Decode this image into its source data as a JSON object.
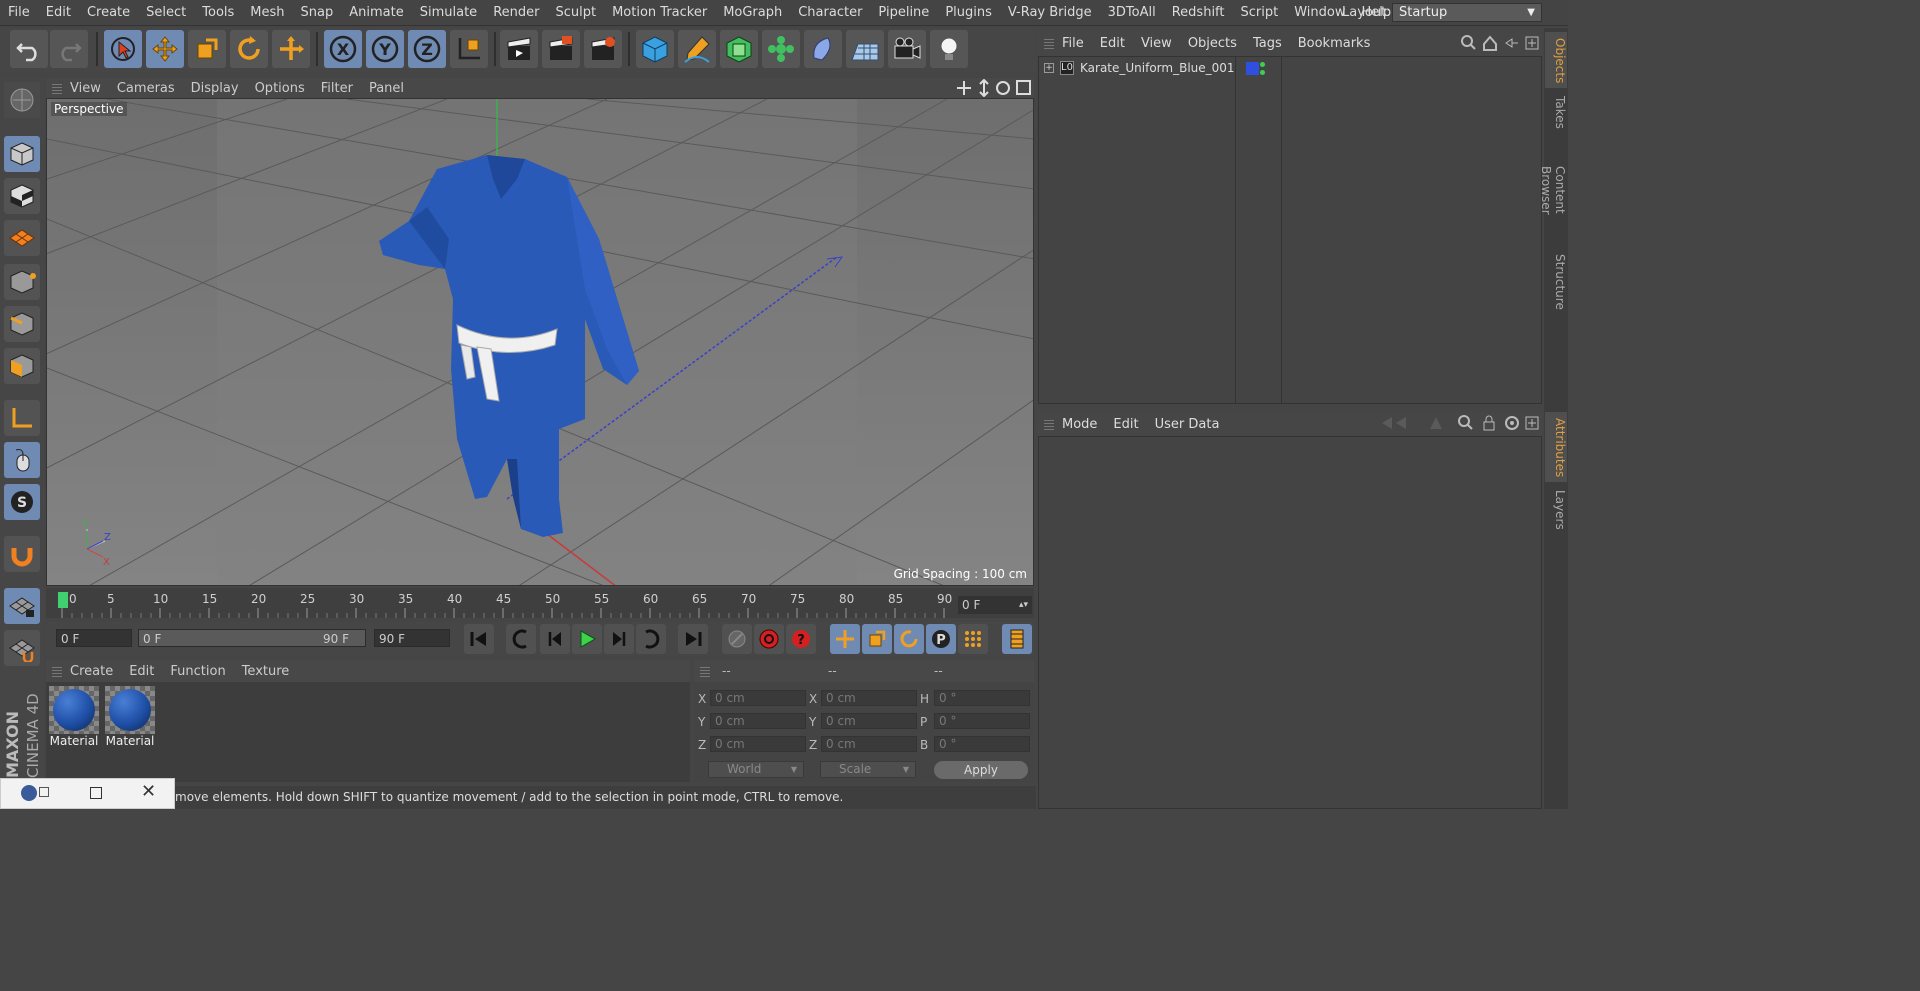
{
  "menubar": {
    "items": [
      "File",
      "Edit",
      "Create",
      "Select",
      "Tools",
      "Mesh",
      "Snap",
      "Animate",
      "Simulate",
      "Render",
      "Sculpt",
      "Motion Tracker",
      "MoGraph",
      "Character",
      "Pipeline",
      "Plugins",
      "V-Ray Bridge",
      "3DToAll",
      "Redshift",
      "Script",
      "Window",
      "Help"
    ],
    "layout_label": "Layout:",
    "layout_value": "Startup"
  },
  "viewport": {
    "menu": [
      "View",
      "Cameras",
      "Display",
      "Options",
      "Filter",
      "Panel"
    ],
    "title": "Perspective",
    "grid_spacing": "Grid Spacing : 100 cm",
    "axis_x": "X",
    "axis_y": "Y",
    "axis_z": "Z"
  },
  "timeline": {
    "ticks": [
      "0",
      "5",
      "10",
      "15",
      "20",
      "25",
      "30",
      "35",
      "40",
      "45",
      "50",
      "55",
      "60",
      "65",
      "70",
      "75",
      "80",
      "85",
      "90"
    ],
    "current_frame": "0 F"
  },
  "transport": {
    "start_field": "0 F",
    "range_start": "0 F",
    "range_end": "90 F",
    "end_field": "90 F"
  },
  "materials": {
    "menu": [
      "Create",
      "Edit",
      "Function",
      "Texture"
    ],
    "items": [
      {
        "label": "Material"
      },
      {
        "label": "Material"
      }
    ]
  },
  "coords": {
    "headers": [
      "--",
      "--",
      "--"
    ],
    "rows": [
      {
        "l1": "X",
        "v1": "0 cm",
        "l2": "X",
        "v2": "0 cm",
        "l3": "H",
        "v3": "0 °"
      },
      {
        "l1": "Y",
        "v1": "0 cm",
        "l2": "Y",
        "v2": "0 cm",
        "l3": "P",
        "v3": "0 °"
      },
      {
        "l1": "Z",
        "v1": "0 cm",
        "l2": "Z",
        "v2": "0 cm",
        "l3": "B",
        "v3": "0 °"
      }
    ],
    "mode1": "World",
    "mode2": "Scale",
    "apply": "Apply"
  },
  "objects": {
    "menu": [
      "File",
      "Edit",
      "View",
      "Objects",
      "Tags",
      "Bookmarks"
    ],
    "item_name": "Karate_Uniform_Blue_001",
    "item_color": "#2f4fe0"
  },
  "attributes": {
    "menu": [
      "Mode",
      "Edit",
      "User Data"
    ]
  },
  "sidetabs": {
    "top": [
      "Objects",
      "Takes",
      "Content Browser",
      "Structure"
    ],
    "bottom": [
      "Attributes",
      "Layers"
    ]
  },
  "status": {
    "text": "move elements. Hold down SHIFT to quantize movement / add to the selection in point mode, CTRL to remove."
  },
  "branding": {
    "maxon": "MAXON",
    "cinema": "CINEMA 4D"
  },
  "colors": {
    "accent": "#6f8ab3",
    "uniform": "#2a5ab8"
  }
}
